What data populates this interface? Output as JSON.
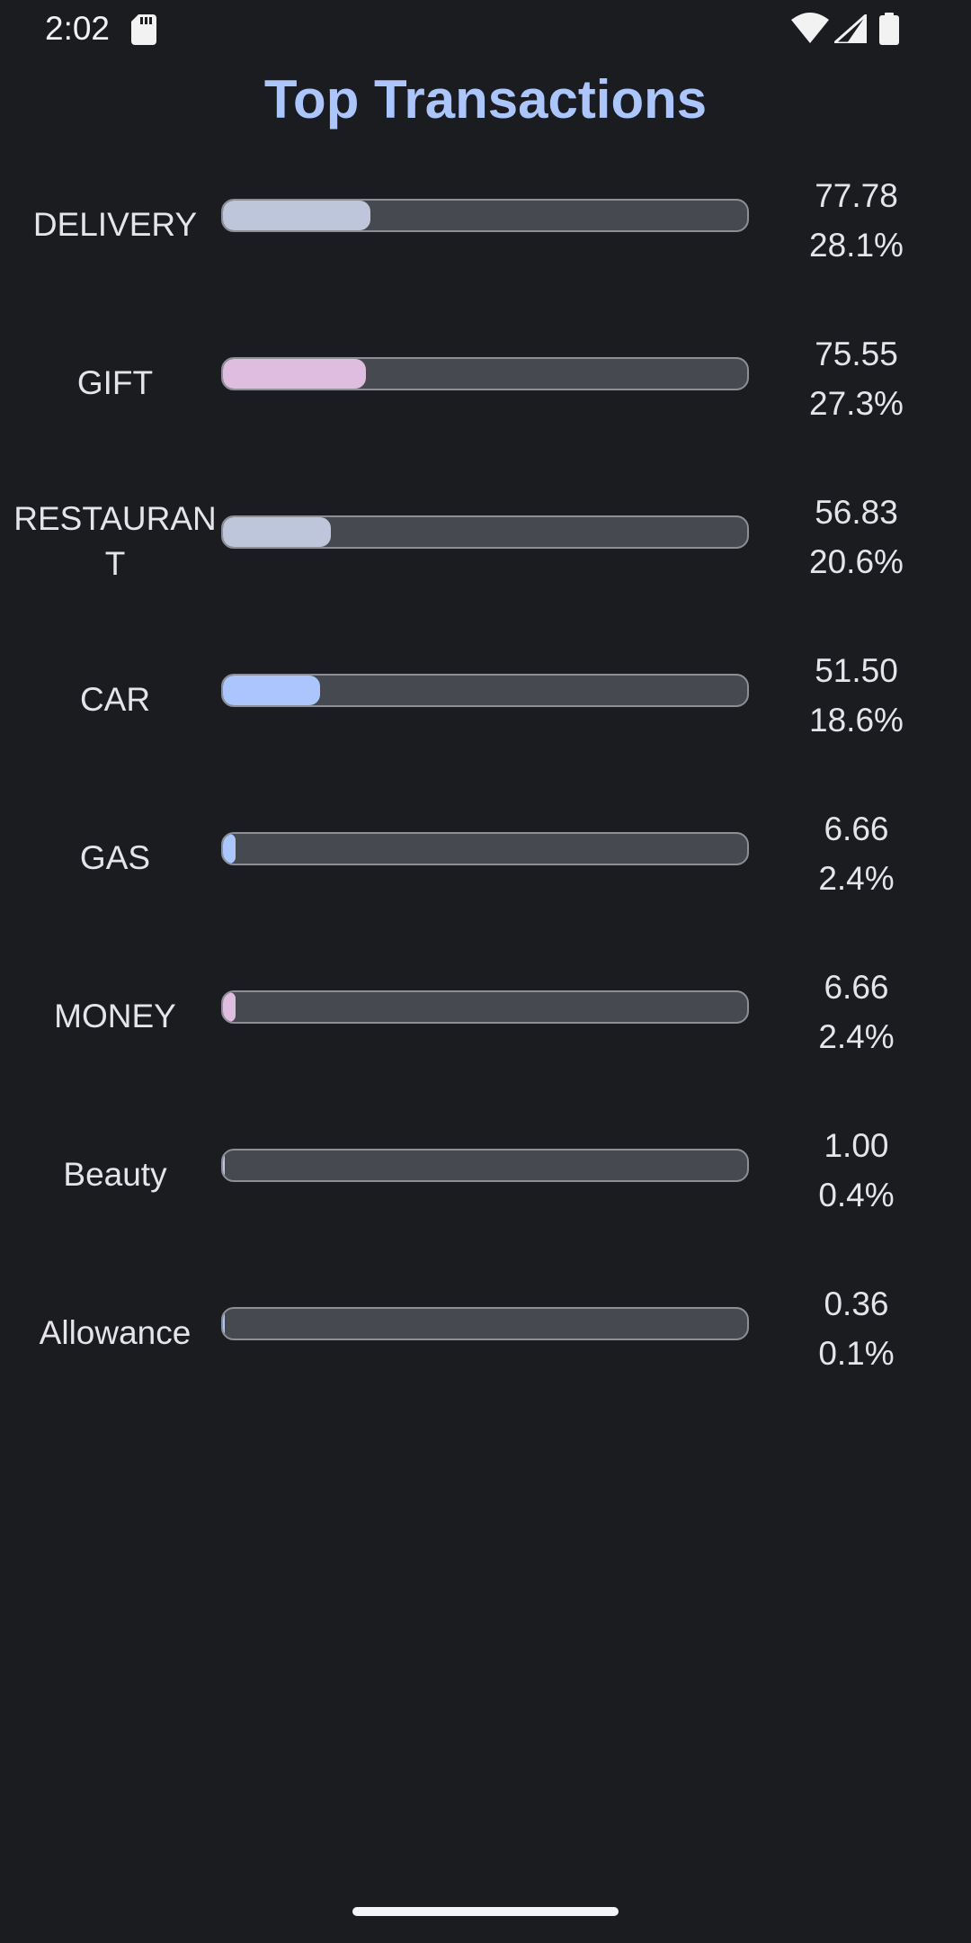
{
  "status_bar": {
    "time": "2:02",
    "icons": [
      "sd-card-icon",
      "wifi-icon",
      "signal-icon",
      "battery-icon"
    ]
  },
  "title": "Top Transactions",
  "colors": {
    "background": "#1b1c20",
    "title": "#abc6ff",
    "track": "#464950",
    "track_border": "#8c8f96"
  },
  "rows": [
    {
      "label": "DELIVERY",
      "amount": "77.78",
      "percent": "28.1%",
      "fraction": 0.281,
      "color": "#bec6dc"
    },
    {
      "label": "GIFT",
      "amount": "75.55",
      "percent": "27.3%",
      "fraction": 0.273,
      "color": "#dfbde0"
    },
    {
      "label": "RESTAURANT",
      "amount": "56.83",
      "percent": "20.6%",
      "fraction": 0.206,
      "color": "#bec6dc"
    },
    {
      "label": "CAR",
      "amount": "51.50",
      "percent": "18.6%",
      "fraction": 0.186,
      "color": "#abc6ff"
    },
    {
      "label": "GAS",
      "amount": "6.66",
      "percent": "2.4%",
      "fraction": 0.024,
      "color": "#abc6ff"
    },
    {
      "label": "MONEY",
      "amount": "6.66",
      "percent": "2.4%",
      "fraction": 0.024,
      "color": "#dfbde0"
    },
    {
      "label": "Beauty",
      "amount": "1.00",
      "percent": "0.4%",
      "fraction": 0.004,
      "color": "#bec6dc"
    },
    {
      "label": "Allowance",
      "amount": "0.36",
      "percent": "0.1%",
      "fraction": 0.001,
      "color": "#abc6ff"
    }
  ]
}
